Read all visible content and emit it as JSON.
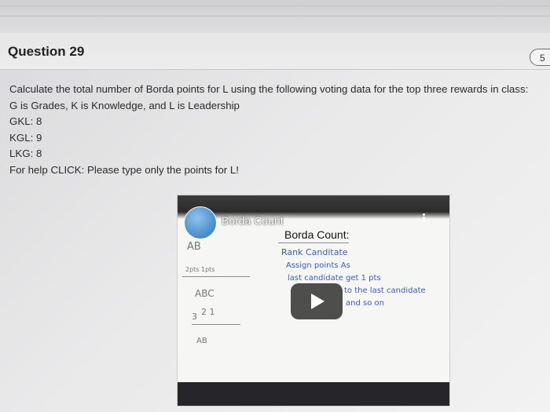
{
  "question": {
    "title": "Question 29",
    "points_label": "5",
    "lines": [
      "Calculate the total number of Borda points for L using the following voting data for the top three rewards in class:",
      "G is Grades, K is Knowledge, and L is Leadership",
      "GKL: 8",
      "KGL: 9",
      "LKG: 8",
      "For help CLICK: Please type only the points for L!"
    ]
  },
  "video": {
    "title": "Borda Count",
    "heading": "Borda Count:",
    "notes": [
      "Rank Canditate",
      "Assign points As",
      "last candidate get 1 pts",
      "to the last candidate",
      "and so on"
    ],
    "sketch": {
      "top_letters": "AB",
      "top_points": "2pts 1pts",
      "mid_letters": "ABC",
      "mid_numbers": "2 1",
      "mid_left_number": "3",
      "bottom_letters": "AB"
    }
  }
}
